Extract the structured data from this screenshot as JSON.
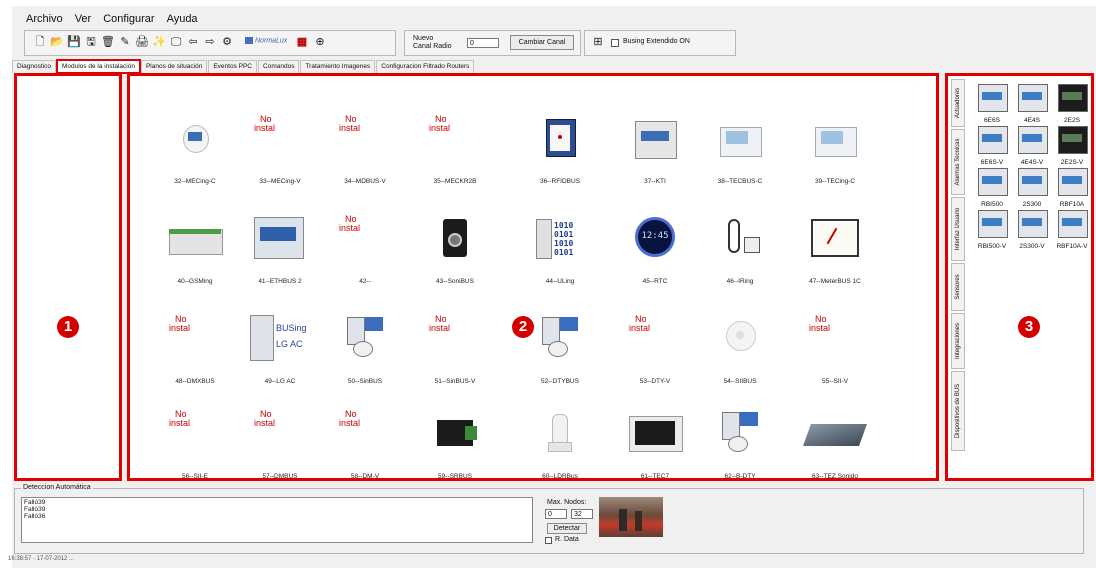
{
  "menu": [
    "Archivo",
    "Ver",
    "Configurar",
    "Ayuda"
  ],
  "toolbar": {
    "icons": [
      "new-file-icon",
      "open-folder-icon",
      "save-icon",
      "save-as-icon",
      "delete-icon",
      "tools-icon",
      "print-icon",
      "wand-icon",
      "monitor-icon",
      "back-arrow-icon",
      "forward-arrow-icon",
      "network-icon"
    ],
    "normalux_label": "NormaLux",
    "nuevo_canal_label": "Nuevo Canal Radio",
    "nuevo_canal_value": "0",
    "cambiar_canal_label": "Cambiar Canal",
    "busing_extendido_label": "Busing Extendido ON"
  },
  "tabs": [
    "Diagnostico",
    "Modulos de la instalación",
    "Planos de situación",
    "Eventos PPC",
    "Comandos",
    "Tratamiento Imagenes",
    "Configuracion Filtrado Routers"
  ],
  "active_tab": 1,
  "markers": [
    "1",
    "2",
    "3"
  ],
  "not_installed_text": [
    "No",
    "instal"
  ],
  "modules": [
    {
      "label": "32--MECing-C",
      "installed": true,
      "icon": "mecing-module-icon"
    },
    {
      "label": "33--MECing-V",
      "installed": false,
      "icon": ""
    },
    {
      "label": "34--MDBUS-V",
      "installed": false,
      "icon": ""
    },
    {
      "label": "35--MECKR2B",
      "installed": false,
      "icon": ""
    },
    {
      "label": "36--RFIDBUS",
      "installed": true,
      "icon": "rfid-reader-icon"
    },
    {
      "label": "37--KTI",
      "installed": true,
      "icon": "din-rail-module-icon"
    },
    {
      "label": "38--TECBUS-C",
      "installed": true,
      "icon": "thermostat-icon"
    },
    {
      "label": "39--TECing-C",
      "installed": true,
      "icon": "thermostat-icon"
    },
    {
      "label": "40--GSMing",
      "installed": true,
      "icon": "gsm-module-icon"
    },
    {
      "label": "41--ETHBUS 2",
      "installed": true,
      "icon": "ethernet-module-icon"
    },
    {
      "label": "42--",
      "installed": false,
      "icon": ""
    },
    {
      "label": "43--SoniBUS",
      "installed": true,
      "icon": "speaker-icon"
    },
    {
      "label": "44--ULing",
      "installed": true,
      "icon": "binary-data-icon"
    },
    {
      "label": "45--RTC",
      "installed": true,
      "icon": "clock-icon"
    },
    {
      "label": "46--IRing",
      "installed": true,
      "icon": "ir-sensor-icon"
    },
    {
      "label": "47--MeterBUS 1C",
      "installed": true,
      "icon": "meter-gauge-icon"
    },
    {
      "label": "48--DMXBUS",
      "installed": false,
      "icon": ""
    },
    {
      "label": "49--LG AC",
      "installed": true,
      "icon": "busing-lg-ac-icon"
    },
    {
      "label": "50--SinBUS",
      "installed": true,
      "icon": "sensor-module-icon"
    },
    {
      "label": "51--SinBUS-V",
      "installed": false,
      "icon": ""
    },
    {
      "label": "52--DTYBUS",
      "installed": true,
      "icon": "sensor-module-icon"
    },
    {
      "label": "53--DTY-V",
      "installed": false,
      "icon": ""
    },
    {
      "label": "54--SIIBUS",
      "installed": true,
      "icon": "smoke-detector-icon"
    },
    {
      "label": "55--SII-V",
      "installed": false,
      "icon": ""
    },
    {
      "label": "56--SII-E",
      "installed": false,
      "icon": ""
    },
    {
      "label": "57--DMBUS",
      "installed": false,
      "icon": ""
    },
    {
      "label": "58--DM-V",
      "installed": false,
      "icon": ""
    },
    {
      "label": "59--SRBUS",
      "installed": true,
      "icon": "relay-module-icon"
    },
    {
      "label": "60--LDRBus",
      "installed": true,
      "icon": "light-sensor-icon"
    },
    {
      "label": "61--TEC7",
      "installed": true,
      "icon": "touch-panel-icon"
    },
    {
      "label": "62--B-DTY",
      "installed": true,
      "icon": "sensor-module-icon"
    },
    {
      "label": "63--TEZ Sonido",
      "installed": true,
      "icon": "sound-mixer-icon"
    }
  ],
  "busing_text": "BUSing",
  "lgac_text": "LG AC",
  "binary_rows": [
    "1010",
    "0101",
    "1010",
    "0101"
  ],
  "clock_text": "12:45",
  "side_tabs": [
    "Actuadores",
    "Alarmas Tecnicas",
    "Interfaz Usuario",
    "Sensores",
    "Integraciones",
    "Dispositivos de BUS"
  ],
  "devices": [
    "6E6S",
    "4E4S",
    "2E2S",
    "6E6S-V",
    "4E4S-V",
    "2E2S-V",
    "RBI500",
    "2S300",
    "RBF10A",
    "RBI500-V",
    "2S300-V",
    "RBF10A-V"
  ],
  "detection": {
    "title": "Deteccion Automática",
    "log": [
      "Falló39",
      "Falló39",
      "Falló36"
    ],
    "max_nodos_label": "Max. Nodos:",
    "min_value": "0",
    "max_value": "32",
    "detectar_label": "Detectar",
    "r_data_label": "R. Data"
  },
  "statusbar": "16:38:57 - 17-07-2012 ..."
}
